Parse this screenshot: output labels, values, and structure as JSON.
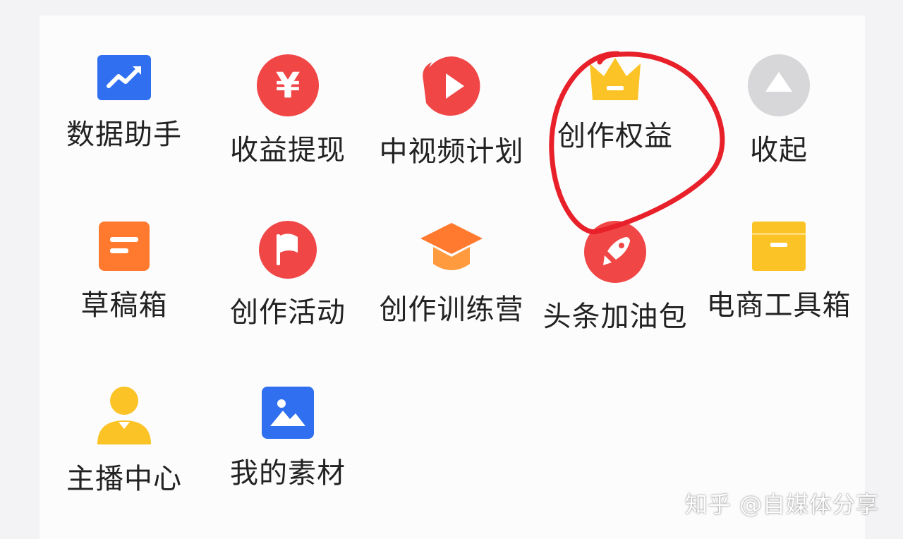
{
  "colors": {
    "blue": "#2f6ff0",
    "red": "#f04646",
    "orange": "#ff7a2e",
    "yellow": "#fcc326",
    "gray": "#d7d7d9",
    "annotation": "#e8202a"
  },
  "grid": {
    "row1": [
      {
        "label": "数据助手",
        "icon": "trend-chart-icon"
      },
      {
        "label": "收益提现",
        "icon": "yuan-coin-icon"
      },
      {
        "label": "中视频计划",
        "icon": "video-play-icon"
      },
      {
        "label": "创作权益",
        "icon": "crown-icon"
      },
      {
        "label": "收起",
        "icon": "collapse-up-icon"
      }
    ],
    "row2": [
      {
        "label": "草稿箱",
        "icon": "draft-box-icon"
      },
      {
        "label": "创作活动",
        "icon": "flag-icon"
      },
      {
        "label": "创作训练营",
        "icon": "graduation-cap-icon"
      },
      {
        "label": "头条加油包",
        "icon": "rocket-icon"
      },
      {
        "label": "电商工具箱",
        "icon": "toolbox-icon"
      }
    ],
    "row3": [
      {
        "label": "主播中心",
        "icon": "anchor-person-icon"
      },
      {
        "label": "我的素材",
        "icon": "image-icon"
      }
    ]
  },
  "watermark": "知乎 @自媒体分享"
}
